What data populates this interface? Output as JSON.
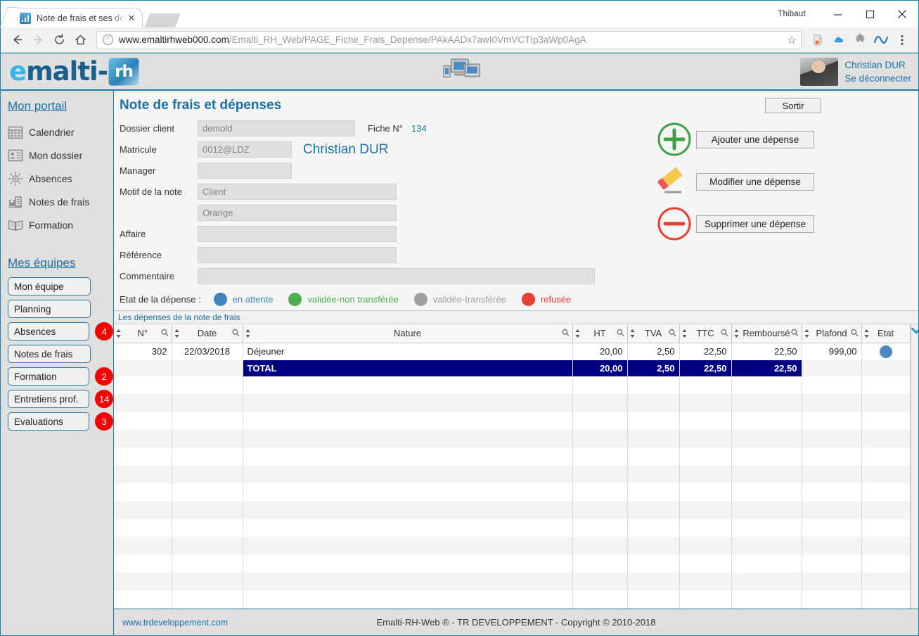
{
  "browser": {
    "tab_title": "Note de frais et ses dépe",
    "tab_close": "✕",
    "url_host": "www.emaltirhweb000.com",
    "url_path": "/Emalti_RH_Web/PAGE_Fiche_Frais_Depense/PAkAADx7awI0VmVCTIp3aWp0AgA",
    "window_user": "Thibaut"
  },
  "header": {
    "logo_e": "e",
    "logo_malti": "malti",
    "logo_dash": "-",
    "logo_box": "rh",
    "user_name": "Christian DUR",
    "logout": "Se déconnecter"
  },
  "sidebar": {
    "portal_heading": "Mon portail",
    "portal_items": [
      {
        "label": "Calendrier",
        "icon": "calendar-icon"
      },
      {
        "label": "Mon dossier",
        "icon": "id-card-icon"
      },
      {
        "label": "Absences",
        "icon": "sun-icon"
      },
      {
        "label": "Notes de frais",
        "icon": "expense-icon"
      },
      {
        "label": "Formation",
        "icon": "book-icon"
      }
    ],
    "teams_heading": "Mes équipes",
    "team_items": [
      {
        "label": "Mon équipe",
        "badge": ""
      },
      {
        "label": "Planning",
        "badge": ""
      },
      {
        "label": "Absences",
        "badge": "4"
      },
      {
        "label": "Notes de frais",
        "badge": ""
      },
      {
        "label": "Formation",
        "badge": "2"
      },
      {
        "label": "Entretiens prof.",
        "badge": "14"
      },
      {
        "label": "Evaluations",
        "badge": "3"
      }
    ]
  },
  "main": {
    "page_title": "Note de frais et dépenses",
    "fields": {
      "dossier_label": "Dossier client",
      "dossier_value": "demold",
      "fiche_label": "Fiche N°",
      "fiche_value": "134",
      "matricule_label": "Matricule",
      "matricule_value": "0012@LDZ",
      "employee_name": "Christian DUR",
      "manager_label": "Manager",
      "manager_value": "",
      "motif_label": "Motif de la note",
      "motif_value": "Client",
      "motif_value2": "Orange",
      "affaire_label": "Affaire",
      "affaire_value": "",
      "reference_label": "Référence",
      "reference_value": "",
      "commentaire_label": "Commentaire",
      "commentaire_value": ""
    },
    "actions": {
      "sortir": "Sortir",
      "add": "Ajouter une dépense",
      "edit": "Modifier une dépense",
      "delete": "Supprimer une dépense"
    },
    "legend": {
      "label": "Etat de la dépense :",
      "items": [
        {
          "text": "en attente",
          "color": "#3f83bf"
        },
        {
          "text": "validée-non transférée",
          "color": "#4caf50"
        },
        {
          "text": "validée-transférée",
          "color": "#9e9e9e"
        },
        {
          "text": "refusée",
          "color": "#e8402e"
        }
      ]
    }
  },
  "table": {
    "caption": "Les dépenses de la note de frais",
    "columns": [
      "N°",
      "Date",
      "Nature",
      "HT",
      "TVA",
      "TTC",
      "Remboursé",
      "Plafond",
      "Etat"
    ],
    "rows": [
      {
        "no": "302",
        "date": "22/03/2018",
        "nature": "Déjeuner",
        "ht": "20,00",
        "tva": "2,50",
        "ttc": "22,50",
        "rembourse": "22,50",
        "plafond": "999,00",
        "etat_color": "#4e88be"
      }
    ],
    "total_row": {
      "label": "TOTAL",
      "ht": "20,00",
      "tva": "2,50",
      "ttc": "22,50",
      "rembourse": "22,50",
      "plafond": "",
      "etat": ""
    },
    "empty_rows": 13
  },
  "footer": {
    "link": "www.trdeveloppement.com",
    "copyright": "Emalti-RH-Web ® - TR DEVELOPPEMENT - Copyright © 2010-2018"
  },
  "colors": {
    "accent_blue": "#1a6fa5",
    "border_blue": "#1a7fa8",
    "total_navy": "#000080",
    "badge_red": "#f40000"
  }
}
